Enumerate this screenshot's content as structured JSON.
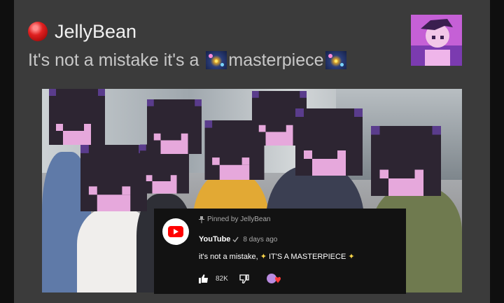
{
  "post": {
    "channel_name": "JellyBean",
    "title_part1": "It's not a mistake it's a",
    "title_part2": "masterpiece"
  },
  "comment": {
    "pinned_label": "Pinned by JellyBean",
    "author": "YouTube",
    "time": "8 days ago",
    "text_part1": "it's not a mistake,",
    "text_part2": "IT'S A MASTERPIECE",
    "likes": "82K"
  },
  "icons": {
    "channel": "red-circle-icon",
    "title": "firework-icon",
    "pin": "pin-icon",
    "verified": "verified-check-icon",
    "sparkle": "sparkles-icon",
    "like": "thumbs-up-icon",
    "dislike": "thumbs-down-icon",
    "creator_heart": "creator-heart-icon"
  },
  "colors": {
    "card_bg": "#3b3b3b",
    "comment_bg": "#121212",
    "youtube_red": "#ff0000",
    "pixel_purple": "#5a3c8c",
    "pixel_pink": "#e6a8dc"
  }
}
